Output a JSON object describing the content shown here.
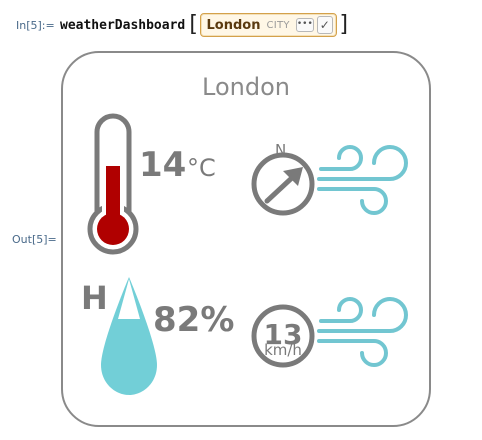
{
  "notebook": {
    "in_label": "In[5]:=",
    "out_label": "Out[5]="
  },
  "input": {
    "function_name": "weatherDashboard",
    "open_bracket": "[",
    "close_bracket": "]",
    "entity": {
      "name": "London",
      "type": "CITY",
      "more_glyph": "•••",
      "check_glyph": "✓"
    }
  },
  "dashboard": {
    "city": "London",
    "temperature": {
      "value": "14",
      "unit": "°C"
    },
    "humidity": {
      "letter": "H",
      "value": "82%"
    },
    "wind_direction": {
      "label": "N"
    },
    "wind_speed": {
      "value": "13",
      "unit": "km/h"
    },
    "colors": {
      "gray": "#7a7a7a",
      "thermometer_red": "#b00000",
      "water_teal": "#72cfd7",
      "wind_teal": "#72c6d1"
    }
  }
}
